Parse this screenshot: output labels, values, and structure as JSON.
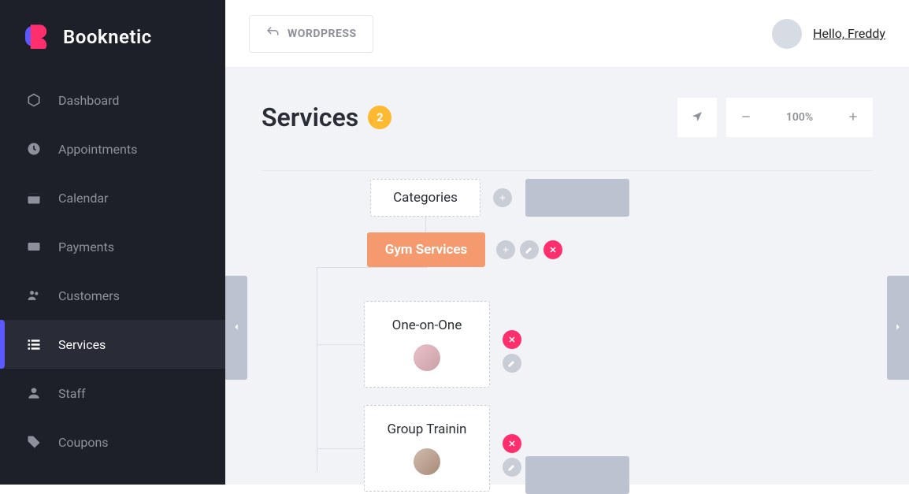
{
  "brand": {
    "name": "Booknetic"
  },
  "topbar": {
    "wp_label": "WORDPRESS",
    "user_greeting": "Hello, Freddy"
  },
  "sidebar": {
    "items": [
      {
        "label": "Dashboard"
      },
      {
        "label": "Appointments"
      },
      {
        "label": "Calendar"
      },
      {
        "label": "Payments"
      },
      {
        "label": "Customers"
      },
      {
        "label": "Services"
      },
      {
        "label": "Staff"
      },
      {
        "label": "Coupons"
      }
    ],
    "active_index": 5
  },
  "page": {
    "title": "Services",
    "count": "2"
  },
  "zoom": {
    "value": "100%"
  },
  "tree": {
    "root_label": "Categories",
    "category": {
      "label": "Gym Services"
    },
    "services": [
      {
        "label": "One-on-One"
      },
      {
        "label": "Group Trainin"
      }
    ]
  }
}
